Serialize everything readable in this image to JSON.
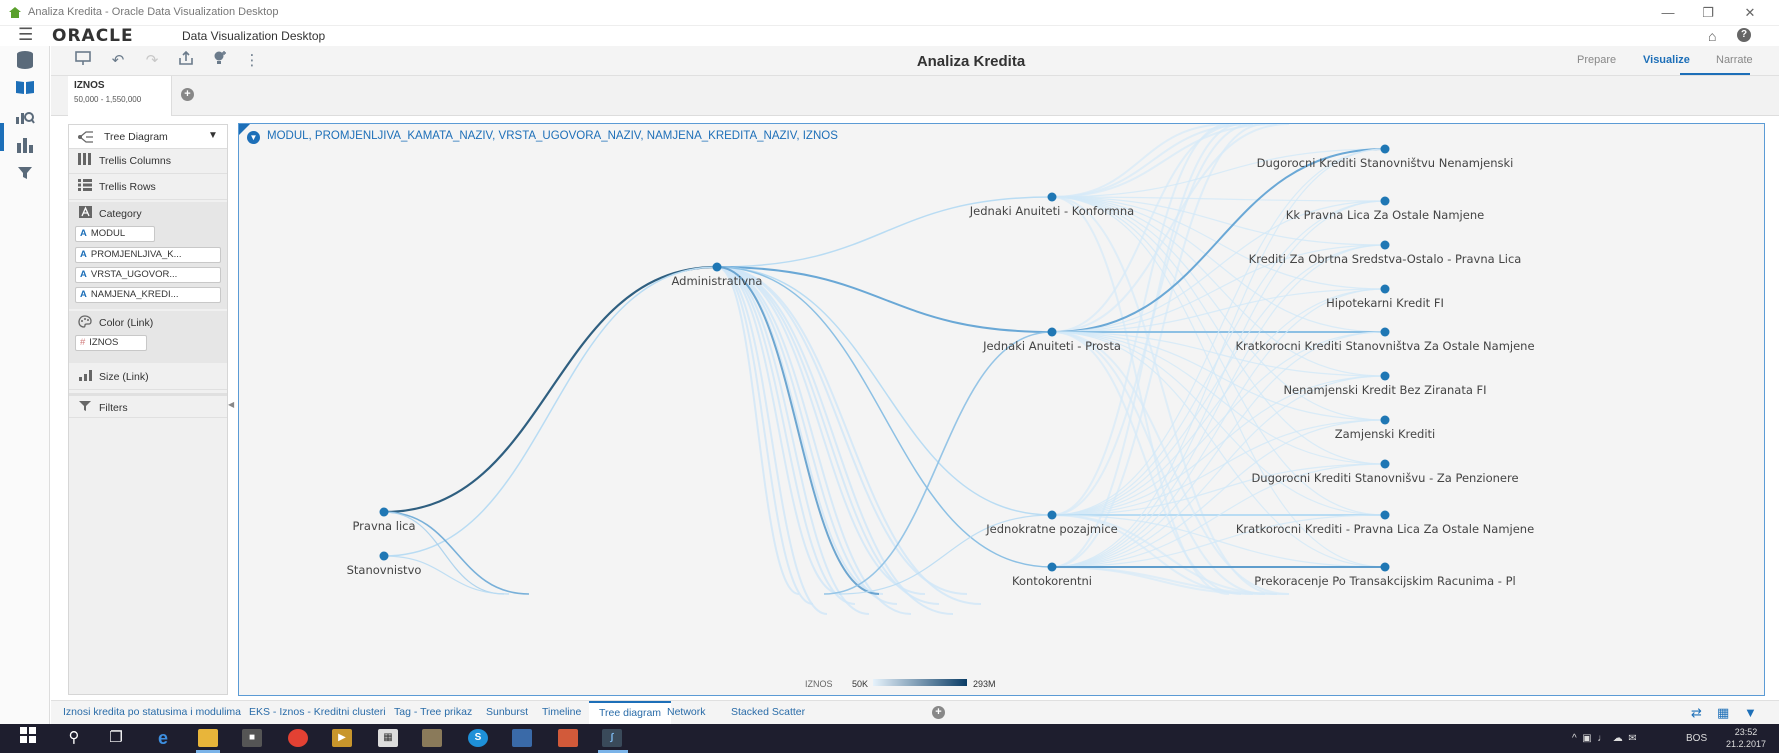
{
  "window": {
    "title": "Analiza Kredita - Oracle Data Visualization Desktop"
  },
  "app": {
    "brand": "ORACLE",
    "product": "Data Visualization Desktop",
    "project_title": "Analiza Kredita"
  },
  "modes": [
    {
      "label": "Prepare",
      "selected": false
    },
    {
      "label": "Visualize",
      "selected": true
    },
    {
      "label": "Narrate",
      "selected": false
    }
  ],
  "filter": {
    "name": "IZNOS",
    "range": "50,000 - 1,550,000"
  },
  "grammar": {
    "viz_type": "Tree Diagram",
    "rows": [
      {
        "label": "Trellis Columns",
        "icon": "trellis-columns-icon"
      },
      {
        "label": "Trellis Rows",
        "icon": "trellis-rows-icon"
      }
    ],
    "category": {
      "label": "Category",
      "items": [
        "MODUL",
        "PROMJENLJIVA_K...",
        "VRSTA_UGOVOR...",
        "NAMJENA_KREDI..."
      ]
    },
    "color": {
      "label": "Color (Link)",
      "items": [
        "IZNOS"
      ]
    },
    "size": {
      "label": "Size (Link)"
    },
    "filters": {
      "label": "Filters"
    }
  },
  "viz": {
    "title": "MODUL, PROMJENLJIVA_KAMATA_NAZIV, VRSTA_UGOVORA_NAZIV, NAMJENA_KREDITA_NAZIV, IZNOS",
    "legend": {
      "measure": "IZNOS",
      "min": "50K",
      "max": "293M"
    },
    "level1": [
      "Pravna lica",
      "Stanovnistvo"
    ],
    "level2": [
      "Administrativna"
    ],
    "level3": [
      "Jednaki Anuiteti - Konformna",
      "Jednaki Anuiteti - Prosta",
      "Jednokratne pozajmice",
      "Kontokorentni"
    ],
    "level4": [
      "Dugorocni Krediti Stanovništvu Nenamjenski",
      "Kk Pravna Lica Za Ostale Namjene",
      "Krediti Za Obrtna Sredstva-Ostalo - Pravna Lica",
      "Hipotekarni Kredit FI",
      "Kratkorocni Krediti Stanovništva Za Ostale Namjene",
      "Nenamjenski Kredit Bez Ziranata FI",
      "Zamjenski Krediti",
      "Dugorocni Krediti Stanovnišvu - Za Penzionere",
      "Kratkorocni Krediti - Pravna Lica Za Ostale Namjene",
      "Prekoracenje Po Transakcijskim Racunima - Pl"
    ]
  },
  "canvas_tabs": [
    {
      "label": "Iznosi kredita po statusima i modulima",
      "selected": false
    },
    {
      "label": "EKS - Iznos - Kreditni clusteri",
      "selected": false
    },
    {
      "label": "Tag - Tree prikaz",
      "selected": false
    },
    {
      "label": "Sunburst",
      "selected": false
    },
    {
      "label": "Timeline",
      "selected": false
    },
    {
      "label": "Tree diagram",
      "selected": true
    },
    {
      "label": "Network",
      "selected": false
    },
    {
      "label": "Stacked Scatter",
      "selected": false
    }
  ],
  "taskbar": {
    "language": "BOS",
    "time": "23:52",
    "date": "21.2.2017"
  },
  "colors": {
    "accent": "#1d6fb8",
    "link_dark": "#2f5f80",
    "link_light": "#cfe6f7",
    "node": "#1f77b4"
  }
}
